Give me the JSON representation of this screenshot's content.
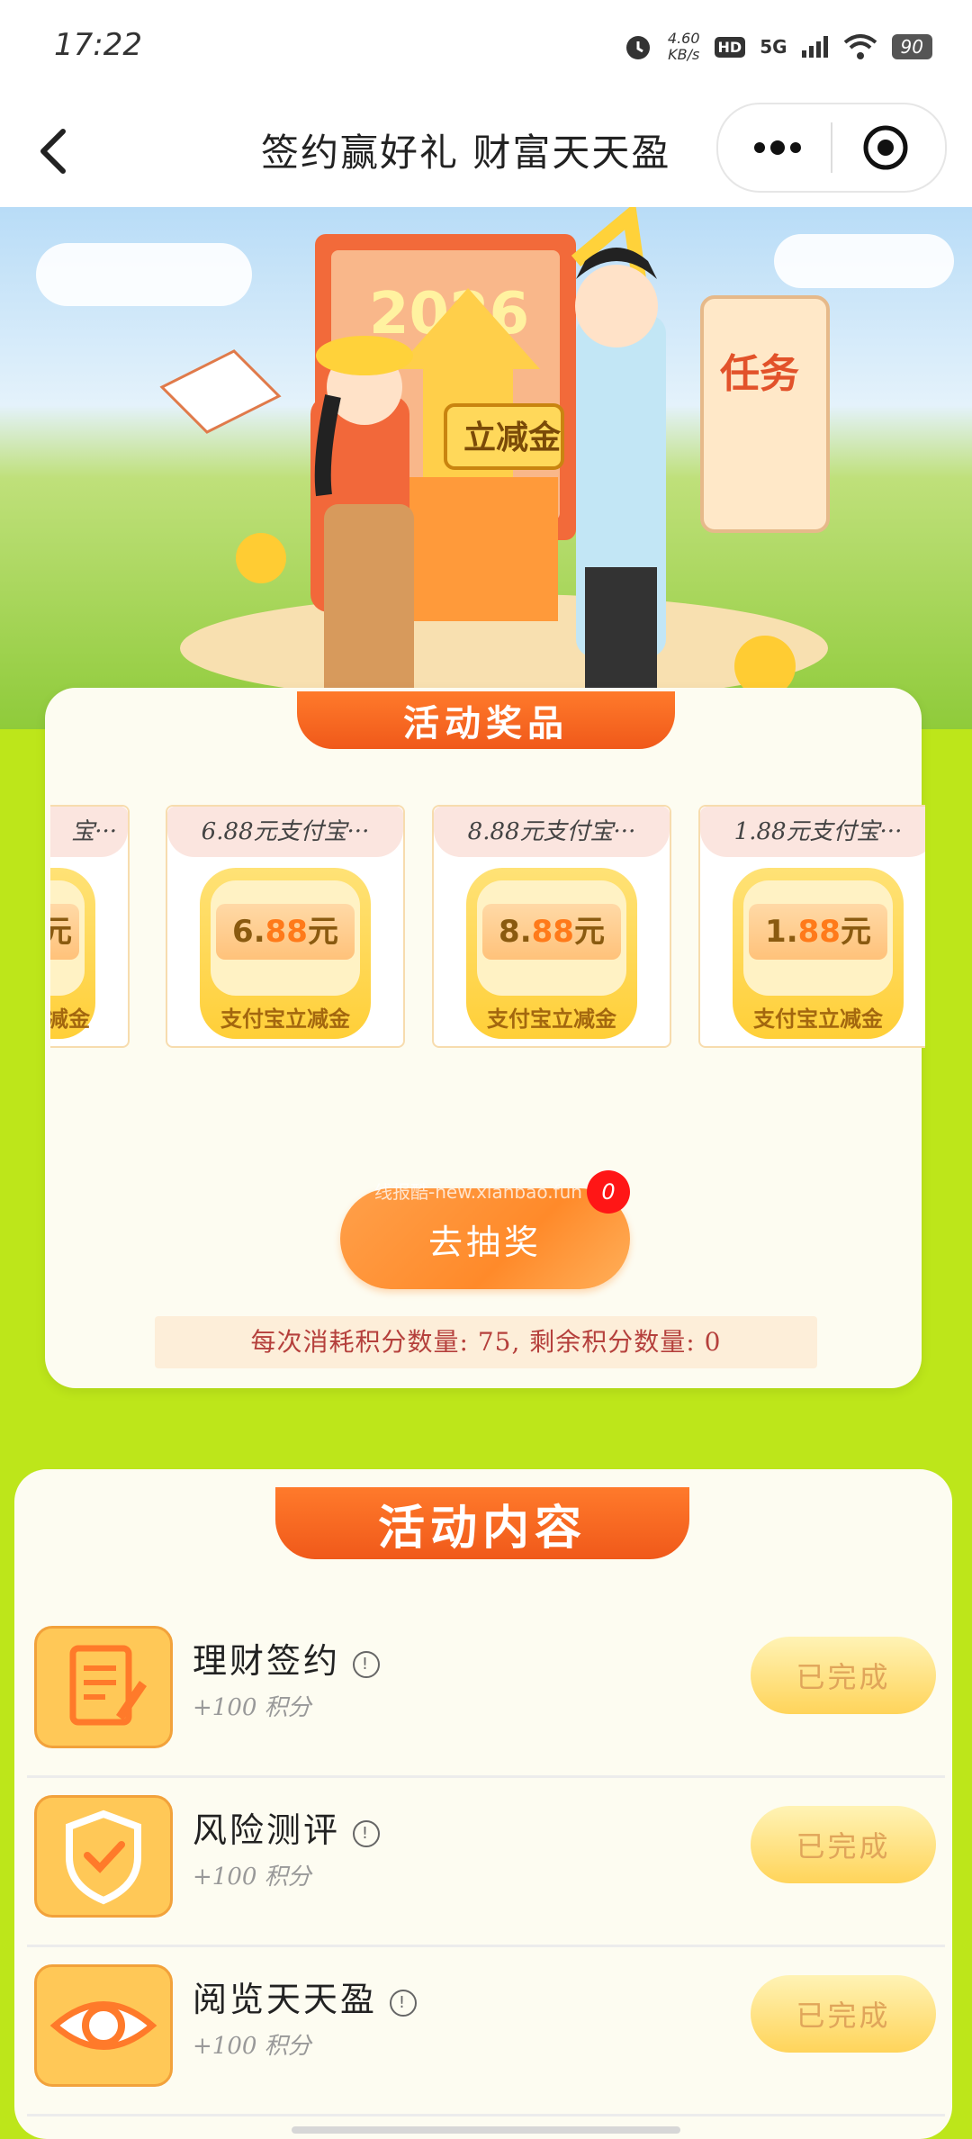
{
  "status_bar": {
    "time": "17:22",
    "speed_value": "4.60",
    "speed_unit": "KB/s",
    "hd": "HD",
    "network": "5G",
    "battery": "90"
  },
  "nav": {
    "title": "签约赢好礼 财富天天盈"
  },
  "banner": {
    "year": "2026",
    "tag": "立减金",
    "scroll_text": "任务"
  },
  "prizes": {
    "title": "活动奖品",
    "items": [
      {
        "name": "宝···",
        "amount": "元",
        "sub": "减金"
      },
      {
        "name": "6.88元支付宝···",
        "amount_int": "6.",
        "amount_dec": "88",
        "unit": "元",
        "sub": "支付宝立减金"
      },
      {
        "name": "8.88元支付宝···",
        "amount_int": "8.",
        "amount_dec": "88",
        "unit": "元",
        "sub": "支付宝立减金"
      },
      {
        "name": "1.88元支付宝···",
        "amount_int": "1.",
        "amount_dec": "88",
        "unit": "元",
        "sub": "支付宝立减金"
      }
    ],
    "draw_button": "去抽奖",
    "draw_badge": "0",
    "watermark": "线报酷-new.xianbao.fun",
    "points_text": "每次消耗积分数量: 75, 剩余积分数量: 0"
  },
  "activities": {
    "title": "活动内容",
    "tasks": [
      {
        "name": "理财签约",
        "points": "+100 积分",
        "status": "已完成",
        "icon": "document-sign-icon"
      },
      {
        "name": "风险测评",
        "points": "+100 积分",
        "status": "已完成",
        "icon": "shield-check-icon"
      },
      {
        "name": "阅览天天盈",
        "points": "+100 积分",
        "status": "已完成",
        "icon": "eye-icon"
      }
    ],
    "info_symbol": "!"
  },
  "colors": {
    "page_bg": "#bde61a",
    "header_orange": "#f0591a",
    "button_orange": "#ff8a2a",
    "badge_red": "#ff1616"
  }
}
